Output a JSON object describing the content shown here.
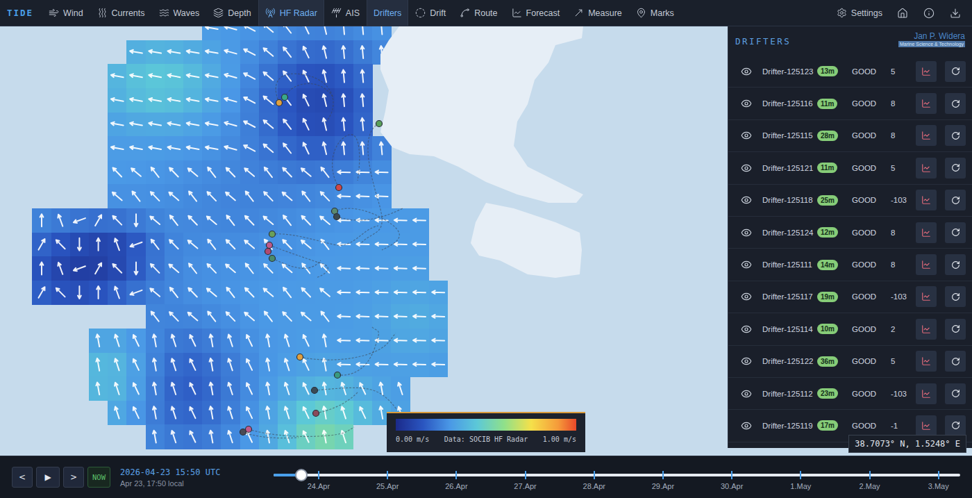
{
  "app": {
    "logo": "TIDE"
  },
  "nav": [
    {
      "label": "Wind",
      "selected": false
    },
    {
      "label": "Currents",
      "selected": false
    },
    {
      "label": "Waves",
      "selected": false
    },
    {
      "label": "Depth",
      "selected": false
    },
    {
      "label": "HF Radar",
      "selected": true
    },
    {
      "label": "AIS",
      "selected": false
    },
    {
      "label": "Drifters",
      "selected": true
    },
    {
      "label": "Drift",
      "selected": false
    },
    {
      "label": "Route",
      "selected": false
    },
    {
      "label": "Forecast",
      "selected": false
    },
    {
      "label": "Measure",
      "selected": false
    },
    {
      "label": "Marks",
      "selected": false
    }
  ],
  "settings": {
    "label": "Settings"
  },
  "map": {
    "legend": {
      "min": "0.00 m/s",
      "source": "Data: SOCIB HF Radar",
      "max": "1.00 m/s"
    },
    "cursor": "38.7073° N, 1.5248° E",
    "drifter_markers": [
      {
        "color": "#3aa88a"
      },
      {
        "color": "#e0a040"
      },
      {
        "color": "#5aa05a"
      },
      {
        "color": "#d04848"
      },
      {
        "color": "#5a8a70"
      },
      {
        "color": "#3a4a50"
      },
      {
        "color": "#6aa05a"
      },
      {
        "color": "#c05a8a"
      },
      {
        "color": "#b04a70"
      },
      {
        "color": "#4a8a6a"
      },
      {
        "color": "#e0a040"
      },
      {
        "color": "#3a9a80"
      },
      {
        "color": "#3a4a55"
      },
      {
        "color": "#8a4a5a"
      },
      {
        "color": "#c05a8a"
      },
      {
        "color": "#4a4a55"
      }
    ]
  },
  "panel": {
    "title": "DRIFTERS",
    "watermark": {
      "name": "Jan P. Widera",
      "subtitle": "Marine Science & Technology"
    },
    "drifters": [
      {
        "name": "Drifter-125123",
        "age": "13m",
        "status": "GOOD",
        "value": "5",
        "visible": true
      },
      {
        "name": "Drifter-125116",
        "age": "11m",
        "status": "GOOD",
        "value": "8",
        "visible": true
      },
      {
        "name": "Drifter-125115",
        "age": "28m",
        "status": "GOOD",
        "value": "8",
        "visible": true
      },
      {
        "name": "Drifter-125121",
        "age": "11m",
        "status": "GOOD",
        "value": "5",
        "visible": true
      },
      {
        "name": "Drifter-125118",
        "age": "25m",
        "status": "GOOD",
        "value": "-103",
        "visible": true
      },
      {
        "name": "Drifter-125124",
        "age": "12m",
        "status": "GOOD",
        "value": "8",
        "visible": true
      },
      {
        "name": "Drifter-125111",
        "age": "14m",
        "status": "GOOD",
        "value": "8",
        "visible": true
      },
      {
        "name": "Drifter-125117",
        "age": "19m",
        "status": "GOOD",
        "value": "-103",
        "visible": true
      },
      {
        "name": "Drifter-125114",
        "age": "10m",
        "status": "GOOD",
        "value": "2",
        "visible": true
      },
      {
        "name": "Drifter-125122",
        "age": "36m",
        "status": "GOOD",
        "value": "5",
        "visible": true
      },
      {
        "name": "Drifter-125112",
        "age": "23m",
        "status": "GOOD",
        "value": "-103",
        "visible": true
      },
      {
        "name": "Drifter-125119",
        "age": "17m",
        "status": "GOOD",
        "value": "-1",
        "visible": true
      }
    ]
  },
  "timeline": {
    "prev": "<",
    "play": "▶",
    "next": ">",
    "now": "NOW",
    "utc": "2026-04-23 15:50 UTC",
    "local": "Apr 23, 17:50 local",
    "level": 0.04,
    "ticks": [
      "24.Apr",
      "25.Apr",
      "26.Apr",
      "27.Apr",
      "28.Apr",
      "29.Apr",
      "30.Apr",
      "1.May",
      "2.May",
      "3.May"
    ]
  }
}
